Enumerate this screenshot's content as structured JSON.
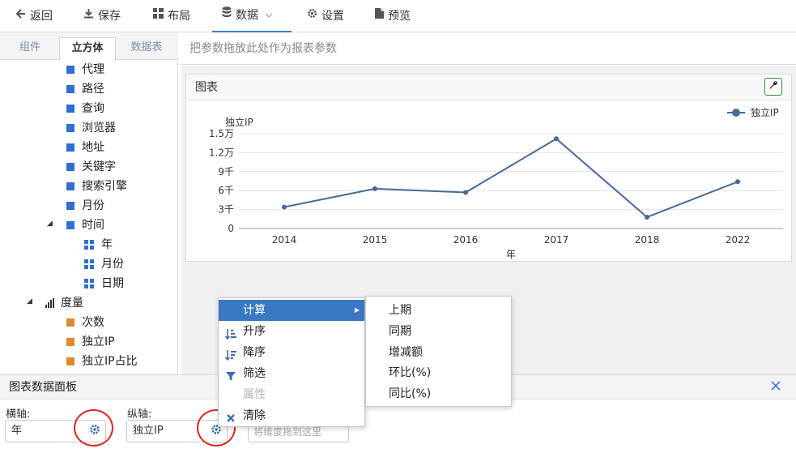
{
  "toolbar": {
    "back": "返回",
    "save": "保存",
    "layout": "布局",
    "data": "数据",
    "settings": "设置",
    "preview": "预览"
  },
  "left_panel": {
    "tabs": [
      "组件",
      "立方体",
      "数据表"
    ],
    "active_tab": "立方体",
    "dimension_items": [
      "代理",
      "路径",
      "查询",
      "浏览器",
      "地址",
      "关键字",
      "搜索引擎",
      "月份"
    ],
    "time_group": {
      "label": "时间",
      "children": [
        "年",
        "月份",
        "日期"
      ]
    },
    "measure_group": {
      "label": "度量",
      "children": [
        "次数",
        "独立IP",
        "独立IP占比"
      ]
    }
  },
  "param_bar": {
    "placeholder": "把参数拖放此处作为报表参数"
  },
  "chart_card": {
    "title": "图表"
  },
  "chart_data": {
    "type": "line",
    "categories": [
      "2014",
      "2015",
      "2016",
      "2017",
      "2018",
      "2022"
    ],
    "series": [
      {
        "name": "独立IP",
        "values": [
          3400,
          6300,
          5700,
          14200,
          1800,
          7400
        ]
      }
    ],
    "xlabel": "年",
    "ylabel": "独立IP",
    "ylim": [
      0,
      15000
    ],
    "y_ticks": [
      0,
      3000,
      6000,
      9000,
      12000,
      15000
    ],
    "y_tick_labels": [
      "0",
      "3千",
      "6千",
      "9千",
      "1.2万",
      "1.5万"
    ],
    "grid": true,
    "legend": "top-right",
    "line_color": "#4a6a9a"
  },
  "bottom_panel": {
    "title": "图表数据面板",
    "x_axis_label": "横轴:",
    "x_axis_value": "年",
    "y_axis_label": "纵轴:",
    "y_axis_value": "独立IP",
    "drop_placeholder": "将维度拖到这里"
  },
  "context_menu": {
    "items": [
      "计算",
      "升序",
      "降序",
      "筛选",
      "属性",
      "清除"
    ],
    "highlighted": "计算",
    "disabled": "属性"
  },
  "sub_menu": {
    "items": [
      "上期",
      "同期",
      "增减额",
      "环比(%)",
      "同比(%)"
    ]
  },
  "colors": {
    "accent": "#3b78c4",
    "dimension": "#2f6fd3",
    "measure": "#e08a2e",
    "annotation": "#d9281f"
  }
}
